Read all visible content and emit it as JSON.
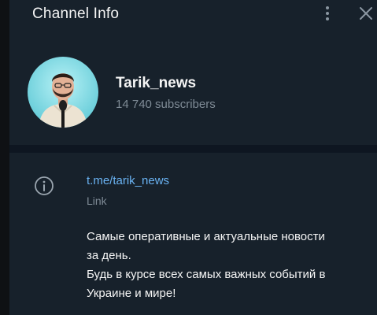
{
  "header": {
    "title": "Channel Info",
    "more_icon": "more-vertical-icon",
    "close_icon": "close-icon"
  },
  "profile": {
    "name": "Tarik_news",
    "subscribers": "14 740 subscribers",
    "avatar_icon": "avatar"
  },
  "info": {
    "icon": "info-icon",
    "link": "t.me/tarik_news",
    "link_label": "Link",
    "description_lines": [
      "Самые оперативные и актуальные новости",
      "за день.",
      "Будь в курсе всех самых важных событий в",
      "Украине и мире!"
    ]
  },
  "colors": {
    "background": "#17212b",
    "accent_link": "#6ab3f3",
    "secondary_text": "#7f8b96",
    "primary_text": "#f5f5f5"
  }
}
